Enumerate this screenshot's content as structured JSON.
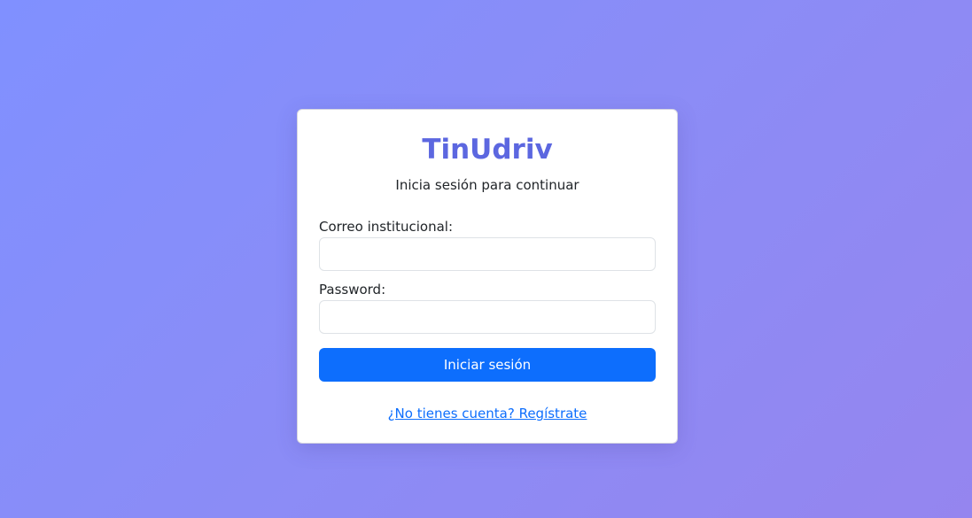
{
  "app": {
    "brand": "TinUdriv",
    "subtitle": "Inicia sesión para continuar"
  },
  "form": {
    "email_label": "Correo institucional:",
    "email_value": "",
    "password_label": "Password:",
    "password_value": "",
    "submit_label": "Iniciar sesión"
  },
  "footer": {
    "register_link": "¿No tienes cuenta? Regístrate"
  },
  "colors": {
    "brand": "#5c67e0",
    "primary": "#0d6efd",
    "background_start": "#8090ff",
    "background_end": "#9585ef"
  }
}
